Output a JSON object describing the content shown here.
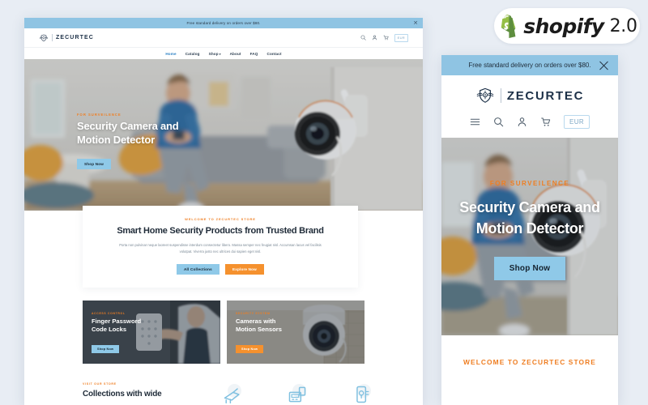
{
  "badge": {
    "word": "shopify",
    "version": "2.0",
    "icon": "shopify-bag-icon"
  },
  "desktop": {
    "announcement": {
      "text": "Free standard delivery on orders over $80.",
      "close_icon": "close-icon"
    },
    "logo": {
      "text": "ZECURTEC",
      "mark": "winged-shield-icon"
    },
    "header_icons": [
      "search-icon",
      "account-icon",
      "cart-icon"
    ],
    "currency": "EUR",
    "nav": [
      {
        "label": "Home",
        "active": true,
        "caret": ""
      },
      {
        "label": "Catalog",
        "active": false,
        "caret": ""
      },
      {
        "label": "Shop",
        "active": false,
        "caret": "▾"
      },
      {
        "label": "About",
        "active": false,
        "caret": ""
      },
      {
        "label": "FAQ",
        "active": false,
        "caret": ""
      },
      {
        "label": "Contact",
        "active": false,
        "caret": ""
      }
    ],
    "hero": {
      "eyebrow": "FOR SURVEILENCE",
      "line1": "Security Camera and",
      "line2": "Motion Detector",
      "button": "Shop Now"
    },
    "welcome": {
      "eyebrow": "WELCOME TO ZECURTEC STORE",
      "heading": "Smart Home Security Products from Trusted Brand",
      "body": "Porta non pulvinar neque laoreet suspendisse interdum consectetur libero. Massa semper nec feugiat nisl. Accumsan lacus vel facilisis volutpat. Viverra justo nec ultrices dui sapien eget nisl.",
      "button_primary": "All Collections",
      "button_secondary": "Explore Now"
    },
    "promos": [
      {
        "eyebrow": "ACCESS CONTROL",
        "line1": "Finger Password",
        "line2": "Code Locks",
        "button": "Shop Now",
        "button_style": "blue"
      },
      {
        "eyebrow": "SECURITY SYSTEM",
        "line1": "Cameras with",
        "line2": "Motion Sensors",
        "button": "Shop Now",
        "button_style": "orange"
      }
    ],
    "collections": {
      "eyebrow": "VISIT OUR STORE",
      "heading": "Collections with wide",
      "icons": [
        "security-camera-icon",
        "alarm-panel-icon",
        "door-lock-icon"
      ]
    }
  },
  "mobile": {
    "announcement": {
      "text": "Free standard delivery on orders over $80.",
      "close_icon": "close-icon"
    },
    "logo": {
      "text": "ZECURTEC",
      "mark": "winged-shield-icon"
    },
    "header_icons": [
      "menu-icon",
      "search-icon",
      "account-icon",
      "cart-icon"
    ],
    "currency": "EUR",
    "hero": {
      "eyebrow": "FOR SURVEILENCE",
      "line1": "Security Camera and",
      "line2": "Motion Detector",
      "button": "Shop Now"
    },
    "welcome": {
      "eyebrow": "WELCOME TO ZECURTEC STORE"
    }
  },
  "colors": {
    "page_background": "#e8edf4",
    "announcement_bar": "#8fc4e3",
    "accent_orange": "#ef7e22",
    "button_orange": "#f5912e",
    "button_blue": "#8fc9e8",
    "heading_dark": "#1f2b38",
    "logo_navy": "#1d3148"
  }
}
